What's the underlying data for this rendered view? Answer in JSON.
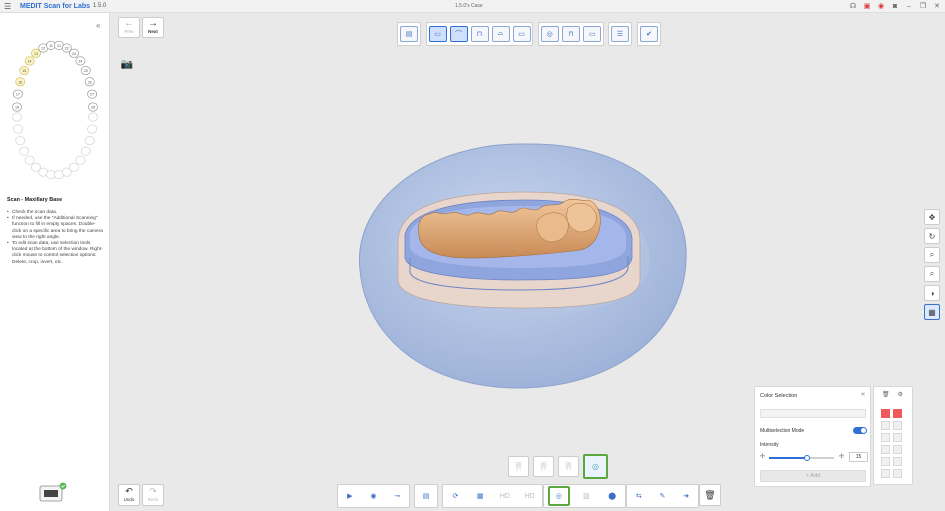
{
  "app": {
    "brand": "MEDIT Scan for Labs",
    "version": "1.5.0",
    "case_title": "1.5.0's Case"
  },
  "nav": {
    "prev_label": "Prev",
    "next_label": "Next"
  },
  "teeth_upper": [
    "18",
    "17",
    "16",
    "15",
    "14",
    "13",
    "12",
    "11",
    "21",
    "22",
    "23",
    "24",
    "25",
    "26",
    "27",
    "28"
  ],
  "teeth_lower": [
    "48",
    "47",
    "46",
    "45",
    "44",
    "43",
    "42",
    "41",
    "31",
    "32",
    "33",
    "34",
    "35",
    "36",
    "37",
    "38"
  ],
  "scan_panel": {
    "title": "Scan - Maxillary Base",
    "instructions": [
      "Check the scan data.",
      "If needed, use the \"Additional Scanning\" function to fill in empty spaces. Double-click on a specific area to bring the camera view to the right angle.",
      "To edit scan data, use selection tools located at the bottom of the window. Right-click mouse to control selection options: Delete, crop, invert, etc."
    ]
  },
  "color_selection": {
    "title": "Color Selection",
    "multiselection_label": "Multiselection Mode",
    "multiselection_on": true,
    "intensity_label": "Intensity",
    "intensity_value": "15",
    "intensity_fraction": 0.58,
    "add_label": "+ Add"
  },
  "bottom": {
    "undo_label": "Undo",
    "redo_label": "Redo",
    "hd_label": "HD"
  },
  "colors": {
    "accent": "#2f6fd6",
    "active_green": "#5aa83f",
    "swatch_red": "#ee5a5a",
    "model_blue": "#a9bde0",
    "teeth": "#e6b283"
  }
}
